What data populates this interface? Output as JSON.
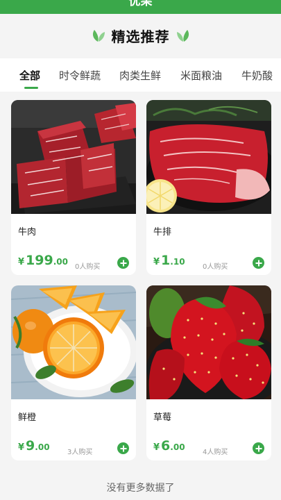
{
  "app": {
    "title": "优果"
  },
  "header": {
    "title": "精选推荐"
  },
  "tabs": [
    {
      "label": "全部"
    },
    {
      "label": "时令鲜蔬"
    },
    {
      "label": "肉类生鲜"
    },
    {
      "label": "米面粮油"
    },
    {
      "label": "牛奶酸"
    }
  ],
  "products": [
    {
      "name": "牛肉",
      "currency": "¥",
      "price_int": "199",
      "price_dec": ".00",
      "sold": "0人购买",
      "image": "beef-cubes-image"
    },
    {
      "name": "牛排",
      "currency": "¥",
      "price_int": "1",
      "price_dec": ".10",
      "sold": "0人购买",
      "image": "steak-image"
    },
    {
      "name": "鲜橙",
      "currency": "¥",
      "price_int": "9",
      "price_dec": ".00",
      "sold": "3人购买",
      "image": "orange-image"
    },
    {
      "name": "草莓",
      "currency": "¥",
      "price_int": "6",
      "price_dec": ".00",
      "sold": "4人购买",
      "image": "strawberry-image"
    }
  ],
  "footer": {
    "text": "没有更多数据了"
  },
  "colors": {
    "accent": "#3aa84a",
    "background": "#f4f4f4"
  }
}
